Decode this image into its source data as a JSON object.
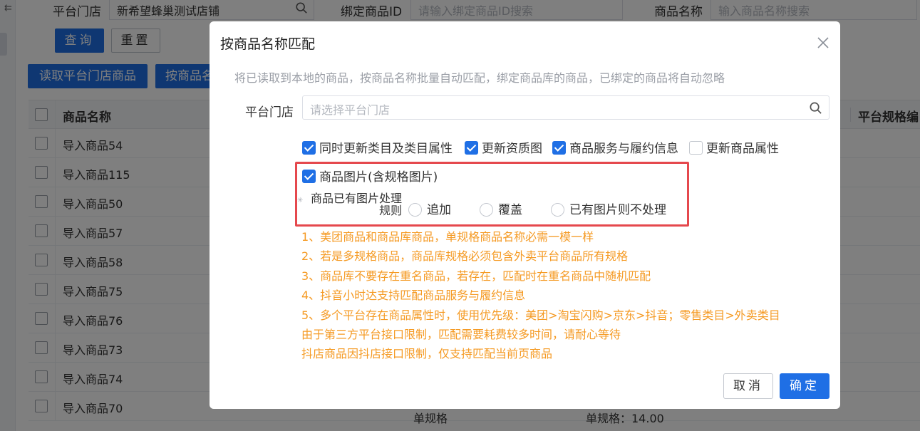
{
  "filters": {
    "store_label": "平台门店",
    "store_value": "新希望蜂巢测试店铺",
    "bind_id_label": "绑定商品ID",
    "bind_id_placeholder": "请输入绑定商品ID搜索",
    "name_label": "商品名称",
    "name_placeholder": "输入商品名称搜索"
  },
  "buttons": {
    "query": "查询",
    "reset": "重置",
    "read_store_goods": "读取平台门店商品",
    "match_by_name_partial": "按商品名"
  },
  "table": {
    "header_name": "商品名称",
    "header_right": "平台规格编",
    "rows": [
      "导入商品54",
      "导入商品115",
      "导入商品50",
      "导入商品57",
      "导入商品58",
      "导入商品75",
      "导入商品76",
      "导入商品73",
      "导入商品74",
      "导入商品70"
    ],
    "last_row_spec": "单规格",
    "last_row_price": "单规格：14.00"
  },
  "modal": {
    "title": "按商品名称匹配",
    "description": "将已读取到本地的商品，按商品名称批量自动匹配，绑定商品库的商品，已绑定的商品将自动忽略",
    "store_label": "平台门店",
    "store_placeholder": "请选择平台门店",
    "options": {
      "update_category": "同时更新类目及类目属性",
      "update_qualification": "更新资质图",
      "service_fulfillment": "商品服务与履约信息",
      "update_attributes": "更新商品属性"
    },
    "image_option": "商品图片(含规格图片)",
    "rule_label_line1": "商品已有图片处理",
    "rule_label_line2": "规则",
    "radios": [
      "追加",
      "覆盖",
      "已有图片则不处理"
    ],
    "notes": [
      "1、美团商品和商品库商品，单规格商品名称必需一模一样",
      "2、若是多规格商品，商品库规格必须包含外卖平台商品所有规格",
      "3、商品库不要存在重名商品，若存在，匹配时在重名商品中随机匹配",
      "4、抖音小时达支持匹配商品服务与履约信息",
      "5、多个平台存在商品属性时，使用优先级：美团>淘宝闪购>京东>抖音；零售类目>外卖类目",
      "由于第三方平台接口限制，匹配需要耗费较多时间，请耐心等待",
      "抖店商品因抖店接口限制，仅支持匹配当前页商品"
    ],
    "cancel": "取消",
    "ok": "确定"
  },
  "colors": {
    "primary": "#1f6fe5",
    "warning_text": "#f59a23",
    "highlight_frame": "#e5484d"
  }
}
